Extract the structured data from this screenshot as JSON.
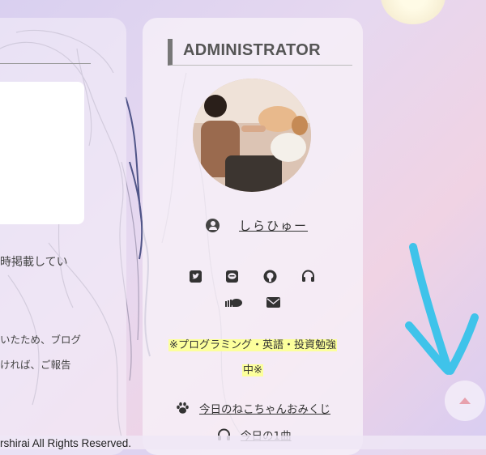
{
  "sidebar": {
    "heading": "ADMINISTRATOR",
    "username": "しらひゅー",
    "bio_line1": "※プログラミング・英語・投資勉強",
    "bio_line2": "中※",
    "links": [
      {
        "label": "今日のねこちゃんおみくじ",
        "icon": "paw-icon"
      },
      {
        "label": "今日の1曲",
        "icon": "headphones-icon"
      }
    ],
    "social_icons": [
      "twitter-icon",
      "line-icon",
      "github-icon",
      "headphones-icon",
      "soundcloud-icon",
      "mail-icon"
    ]
  },
  "left_card": {
    "text1": "時掲載してい",
    "text2": "いたため、ブログ",
    "text3": "ければ、ご報告"
  },
  "footer": {
    "copyright": "rshirai All Rights Reserved."
  },
  "colors": {
    "accent_blue": "#3fc3ea",
    "highlight": "#fcff9c",
    "scroll_arrow": "#e7a0ad"
  }
}
